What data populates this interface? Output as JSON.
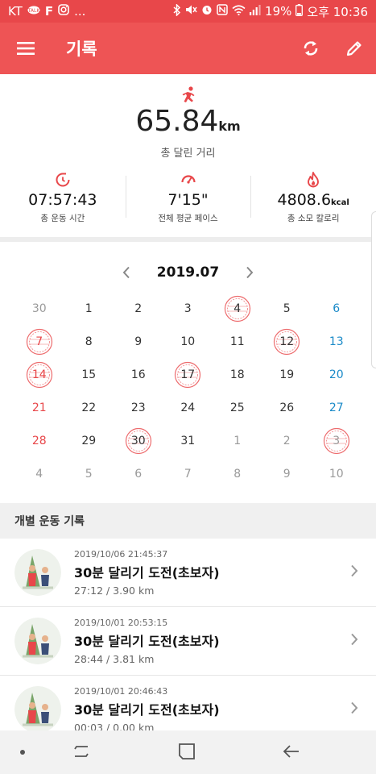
{
  "status_bar": {
    "carrier": "KT",
    "notif_extra": "...",
    "battery": "19%",
    "time": "오후 10:36"
  },
  "app_bar": {
    "title": "기록"
  },
  "summary": {
    "distance_value": "65.84",
    "distance_unit": "km",
    "distance_label": "총 달린 거리",
    "stats": [
      {
        "value": "07:57:43",
        "unit": "",
        "label": "총 운동 시간",
        "icon": "timer-icon"
      },
      {
        "value": "7'15\"",
        "unit": "",
        "label": "전체 평균 페이스",
        "icon": "speedometer-icon"
      },
      {
        "value": "4808.6",
        "unit": "kcal",
        "label": "총 소모 칼로리",
        "icon": "flame-icon"
      }
    ]
  },
  "calendar": {
    "month": "2019.07",
    "days": [
      [
        "30",
        "1",
        "2",
        "3",
        "4",
        "5",
        "6"
      ],
      [
        "7",
        "8",
        "9",
        "10",
        "11",
        "12",
        "13"
      ],
      [
        "14",
        "15",
        "16",
        "17",
        "18",
        "19",
        "20"
      ],
      [
        "21",
        "22",
        "23",
        "24",
        "25",
        "26",
        "27"
      ],
      [
        "28",
        "29",
        "30",
        "31",
        "1",
        "2",
        "3"
      ],
      [
        "4",
        "5",
        "6",
        "7",
        "8",
        "9",
        "10"
      ]
    ],
    "stamped": [
      "4",
      "7",
      "12",
      "14",
      "17",
      "30",
      "3-aug"
    ]
  },
  "records": {
    "header": "개별 운동 기록",
    "items": [
      {
        "date": "2019/10/06 21:45:37",
        "title": "30분 달리기 도전(초보자)",
        "meta": "27:12 / 3.90 km"
      },
      {
        "date": "2019/10/01 20:53:15",
        "title": "30분 달리기 도전(초보자)",
        "meta": "28:44 / 3.81 km"
      },
      {
        "date": "2019/10/01 20:46:43",
        "title": "30분 달리기 도전(초보자)",
        "meta": "00:03 / 0.00 km"
      }
    ]
  },
  "colors": {
    "primary": "#ee5455",
    "status": "#e8474a",
    "sunday": "#e8474a",
    "saturday": "#1a8ac8"
  }
}
